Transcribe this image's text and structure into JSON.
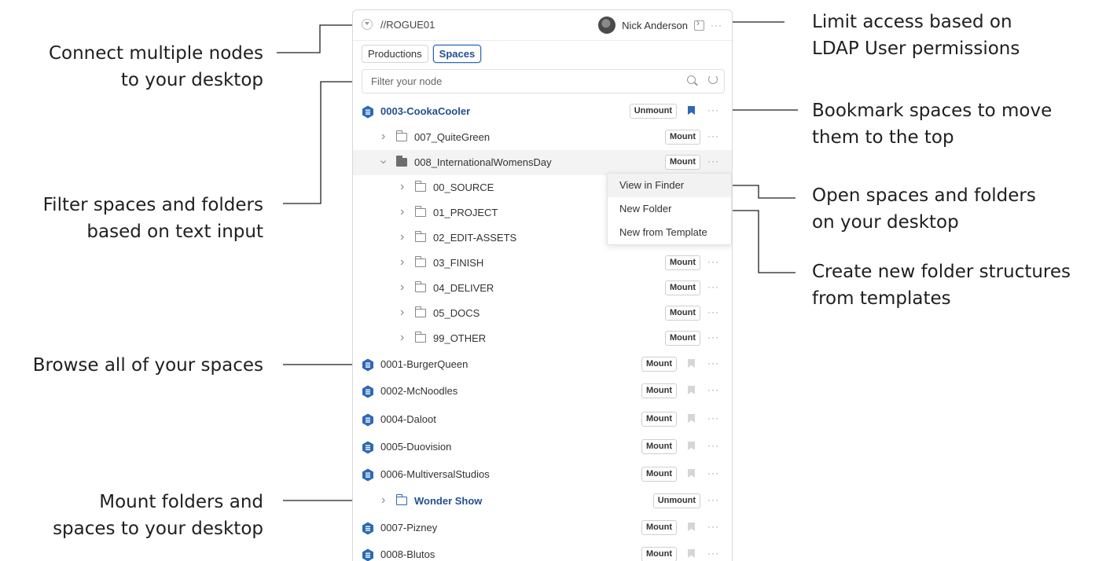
{
  "annotations": {
    "connect_nodes": [
      "Connect multiple nodes",
      "to your desktop"
    ],
    "filter": [
      "Filter spaces and folders",
      "based on text input"
    ],
    "browse": [
      "Browse all of your spaces"
    ],
    "mount": [
      "Mount folders and",
      "spaces to your desktop"
    ],
    "ldap": [
      "Limit access based on",
      "LDAP User permissions"
    ],
    "bookmark": [
      "Bookmark spaces to move",
      "them to the top"
    ],
    "open": [
      "Open spaces and folders",
      "on your desktop"
    ],
    "create": [
      "Create new folder structures",
      "from templates"
    ]
  },
  "header": {
    "node_name": "//ROGUE01",
    "user_name": "Nick Anderson",
    "more": "···"
  },
  "tabs": [
    {
      "label": "Productions",
      "active": false
    },
    {
      "label": "Spaces",
      "active": true
    }
  ],
  "filter": {
    "placeholder": "Filter your node"
  },
  "rows": {
    "r0": {
      "label": "0003-CookaCooler",
      "action": "Unmount"
    },
    "r1": {
      "label": "007_QuiteGreen",
      "action": "Mount"
    },
    "r2": {
      "label": "008_InternationalWomensDay",
      "action": "Mount"
    },
    "r3": {
      "label": "00_SOURCE"
    },
    "r4": {
      "label": "01_PROJECT"
    },
    "r5": {
      "label": "02_EDIT-ASSETS"
    },
    "r6": {
      "label": "03_FINISH",
      "action": "Mount"
    },
    "r7": {
      "label": "04_DELIVER",
      "action": "Mount"
    },
    "r8": {
      "label": "05_DOCS",
      "action": "Mount"
    },
    "r9": {
      "label": "99_OTHER",
      "action": "Mount"
    },
    "r10": {
      "label": "0001-BurgerQueen",
      "action": "Mount"
    },
    "r11": {
      "label": "0002-McNoodles",
      "action": "Mount"
    },
    "r12": {
      "label": "0004-Daloot",
      "action": "Mount"
    },
    "r13": {
      "label": "0005-Duovision",
      "action": "Mount"
    },
    "r14": {
      "label": "0006-MultiversalStudios",
      "action": "Mount"
    },
    "r15": {
      "label": "Wonder Show",
      "action": "Unmount"
    },
    "r16": {
      "label": "0007-Pizney",
      "action": "Mount"
    },
    "r17": {
      "label": "0008-Blutos",
      "action": "Mount"
    }
  },
  "context_menu": [
    "View in Finder",
    "New Folder",
    "New from Template"
  ],
  "colors": {
    "accent": "#2e69b4",
    "bookmark_active": "#2e69b4",
    "bookmark_inactive": "#d6d6d6"
  }
}
